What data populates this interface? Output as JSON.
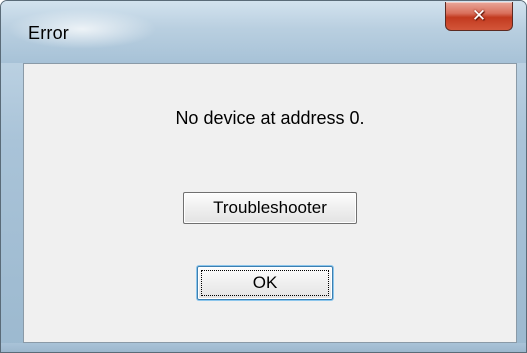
{
  "window": {
    "title": "Error",
    "close_icon": "close-icon",
    "close_glyph": "✕"
  },
  "dialog": {
    "message": "No device at address 0.",
    "troubleshooter_label": "Troubleshooter",
    "ok_label": "OK"
  },
  "colors": {
    "title_bar": "#b9cfe0",
    "close_button": "#c23a1f",
    "client_background": "#f0f0f0",
    "default_button_border": "#3c7fb1"
  }
}
